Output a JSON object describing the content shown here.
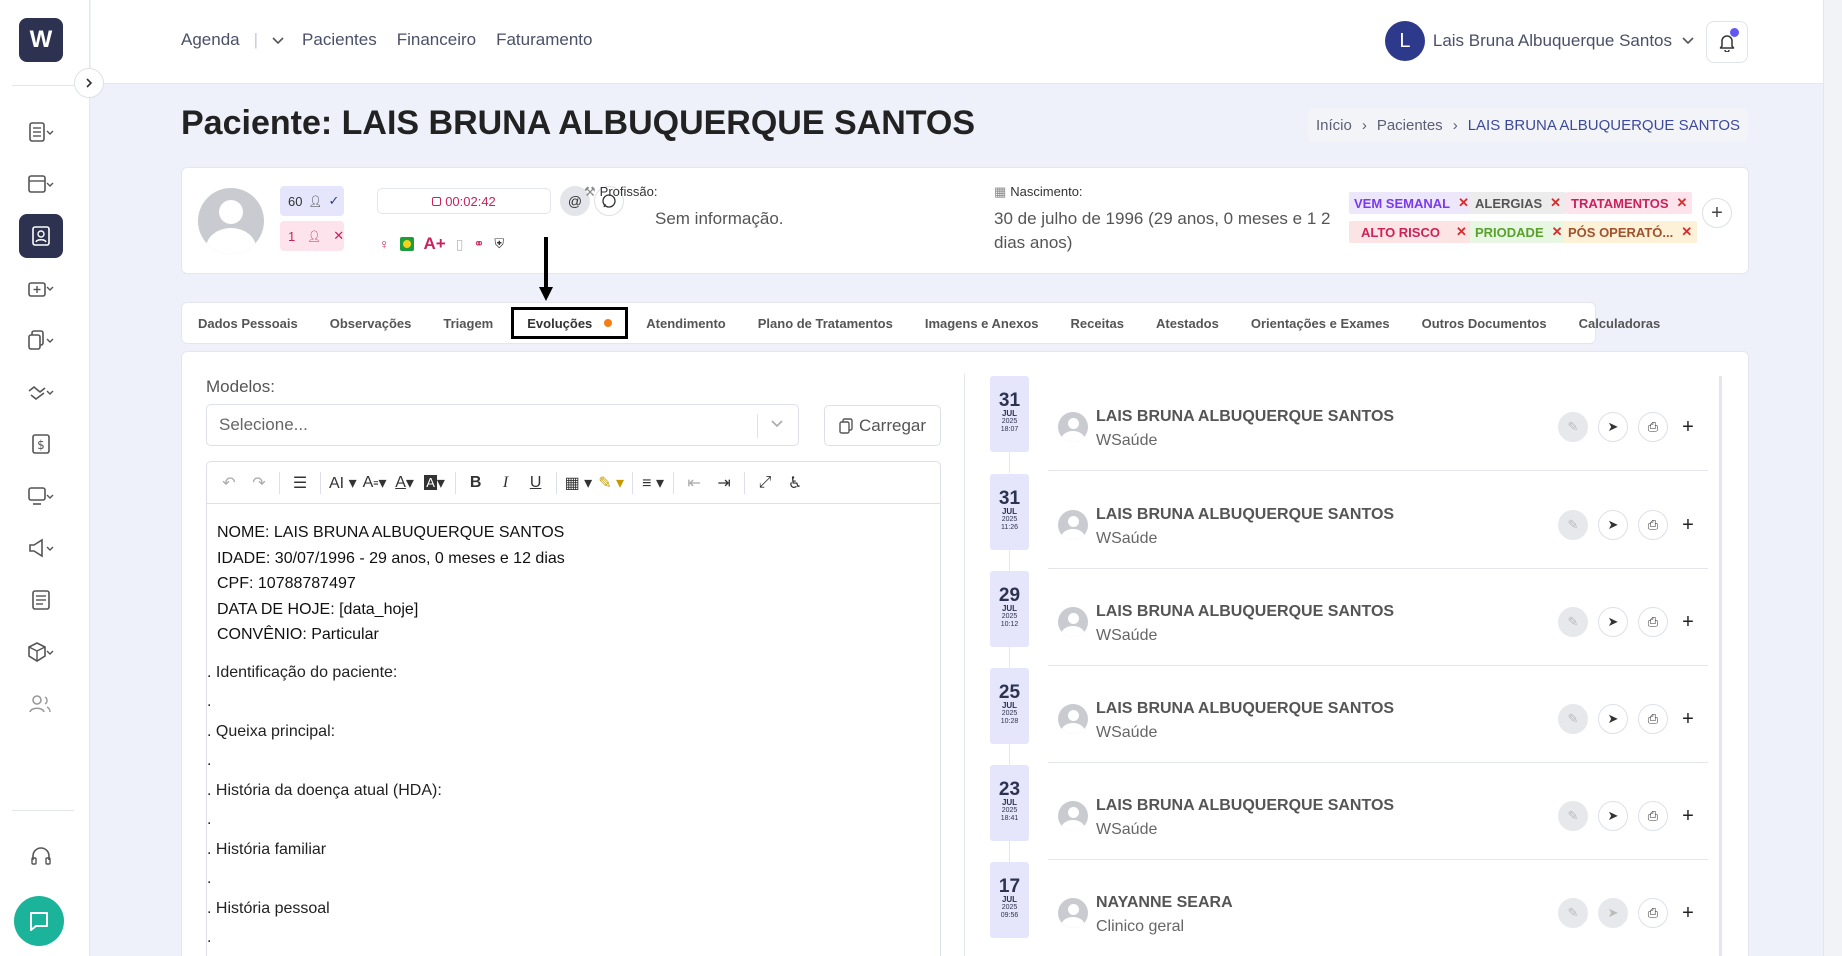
{
  "app": {
    "logo": "W"
  },
  "nav": {
    "agenda": "Agenda",
    "pacientes": "Pacientes",
    "financeiro": "Financeiro",
    "faturamento": "Faturamento"
  },
  "user": {
    "initial": "L",
    "name": "Lais Bruna Albuquerque Santos"
  },
  "page": {
    "title": "Paciente: LAIS BRUNA ALBUQUERQUE SANTOS"
  },
  "breadcrumb": {
    "home": "Início",
    "patients": "Pacientes",
    "current": "LAIS BRUNA ALBUQUERQUE SANTOS"
  },
  "patient": {
    "count_blue": "60",
    "count_pink": "1",
    "timer": "00:02:42",
    "blood_type": "A+",
    "profession_label": "Profissão:",
    "profession_value": "Sem informação.",
    "birth_label": "Nascimento:",
    "birth_value": "30 de julho de 1996 (29 anos, 0 meses e 1 2 dias anos)",
    "tags": [
      "VEM SEMANAL",
      "ALERGIAS",
      "TRATAMENTOS",
      "ALTO RISCO",
      "PRIODADE",
      "PÓS OPERATÓ..."
    ]
  },
  "tabs": [
    "Dados Pessoais",
    "Observações",
    "Triagem",
    "Evoluções",
    "Atendimento",
    "Plano de Tratamentos",
    "Imagens e Anexos",
    "Receitas",
    "Atestados",
    "Orientações e Exames",
    "Outros Documentos",
    "Calculadoras"
  ],
  "active_tab": "Evoluções",
  "modelos": {
    "label": "Modelos:",
    "placeholder": "Selecione...",
    "load_button": "Carregar"
  },
  "editor": {
    "lines": [
      "NOME: LAIS BRUNA ALBUQUERQUE SANTOS",
      "IDADE: 30/07/1996 - 29 anos, 0 meses e 12 dias",
      "CPF: 10788787497",
      "DATA DE HOJE: [data_hoje]",
      "CONVÊNIO: Particular"
    ],
    "sections": [
      ". Identificação do paciente:",
      ".",
      ". Queixa principal:",
      ".",
      ". História da doença atual (HDA):",
      ".",
      ". História familiar",
      ".",
      ". História pessoal",
      "."
    ]
  },
  "timeline": [
    {
      "day": "31",
      "month": "JUL",
      "year": "2025",
      "time": "18:07",
      "name": "LAIS BRUNA ALBUQUERQUE SANTOS",
      "sub": "WSaúde"
    },
    {
      "day": "31",
      "month": "JUL",
      "year": "2025",
      "time": "11:26",
      "name": "LAIS BRUNA ALBUQUERQUE SANTOS",
      "sub": "WSaúde"
    },
    {
      "day": "29",
      "month": "JUL",
      "year": "2025",
      "time": "10:12",
      "name": "LAIS BRUNA ALBUQUERQUE SANTOS",
      "sub": "WSaúde"
    },
    {
      "day": "25",
      "month": "JUL",
      "year": "2025",
      "time": "10:28",
      "name": "LAIS BRUNA ALBUQUERQUE SANTOS",
      "sub": "WSaúde"
    },
    {
      "day": "23",
      "month": "JUL",
      "year": "2025",
      "time": "18:41",
      "name": "LAIS BRUNA ALBUQUERQUE SANTOS",
      "sub": "WSaúde"
    },
    {
      "day": "17",
      "month": "JUL",
      "year": "2025",
      "time": "09:56",
      "name": "NAYANNE SEARA",
      "sub": "Clinico geral"
    }
  ],
  "colors": {
    "primary": "#2d3250",
    "accent": "#c8235a",
    "tab_dot": "#f57d12",
    "chat": "#1bb39a"
  }
}
